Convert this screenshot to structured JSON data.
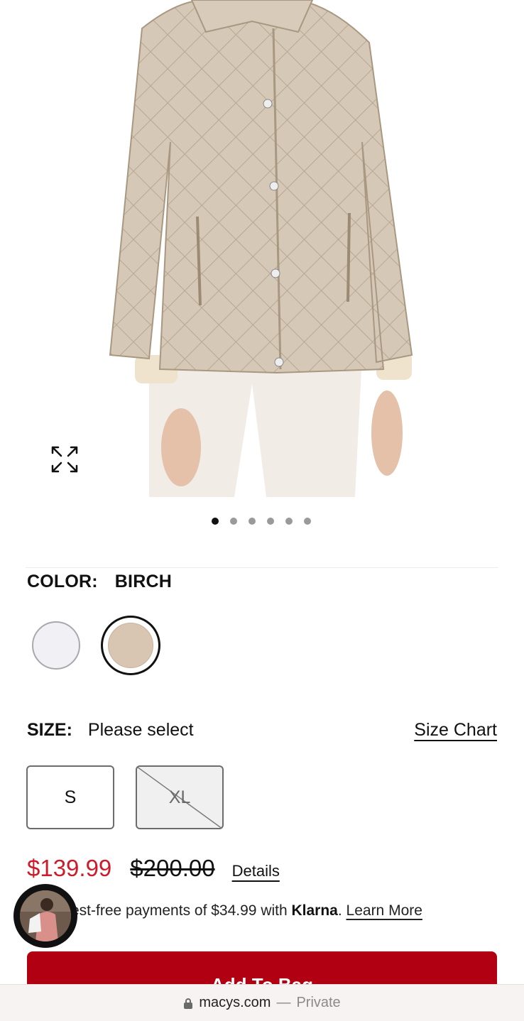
{
  "product_image": {
    "alt": ""
  },
  "carousel": {
    "count": 6,
    "active_index": 0
  },
  "color": {
    "label": "COLOR:",
    "selected": "BIRCH",
    "options": [
      "white-swatch",
      "birch-swatch"
    ]
  },
  "size": {
    "label": "SIZE:",
    "prompt": "Please select",
    "chart_link": "Size Chart",
    "options": [
      "S",
      "XL"
    ],
    "unavailable": [
      "XL"
    ]
  },
  "price": {
    "sale": "$139.99",
    "original": "$200.00",
    "details_link": "Details"
  },
  "klarna": {
    "prefix": "est-free payments of $34.99 with ",
    "brand": "Klarna",
    "suffix": ". ",
    "learn_more": "Learn More"
  },
  "add_to_bag": {
    "label": "Add To Bag"
  },
  "browser": {
    "domain": "macys.com",
    "separator": "—",
    "mode": "Private"
  },
  "colors": {
    "sale_red": "#cc1c2c",
    "button_red": "#b00012",
    "birch": "#d8c6b2"
  }
}
